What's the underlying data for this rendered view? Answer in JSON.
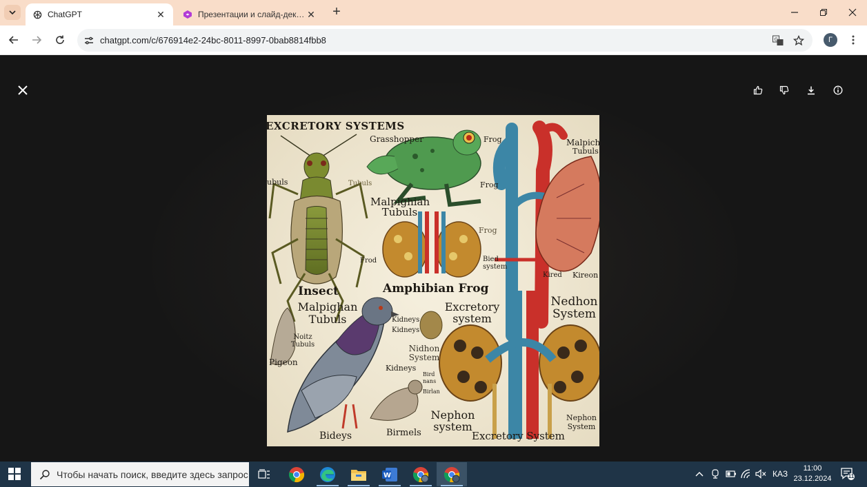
{
  "browser": {
    "tabs": [
      {
        "title": "ChatGPT",
        "active": true
      },
      {
        "title": "Презентации и слайд-деки с AI",
        "active": false
      }
    ],
    "address": "chatgpt.com/c/676914e2-24bc-8011-8997-0bab8814fbb8",
    "profile_initial": "Г"
  },
  "viewer": {
    "actions": [
      "thumbs-up",
      "thumbs-down",
      "download",
      "info"
    ]
  },
  "artwork": {
    "labels": {
      "title": "EXCRETORY SYSTEMS",
      "grasshopper": "Grasshopper",
      "frog_top": "Frog",
      "malpich": "Malpich",
      "tubuls_top": "Tubuls",
      "tubuls_left": "ubuls",
      "tubuls_insect": "Tubuls",
      "frog_mid": "Frog",
      "malpighian_tubuls_mid": "Malpighian Tubuls",
      "frog_small": "Frog",
      "frod": "Frod",
      "bird_system": "Bied system",
      "kired": "Kired",
      "kireon": "Kireon",
      "insect": "Insect",
      "amphibian_frog": "Amphibian Frog",
      "malpighan_tubuls": "Malpighan Tubuls",
      "excretory_system_mid": "Excretory system",
      "nedhon_system": "Nedhon System",
      "kidneys1": "Kidneys",
      "kidneys2": "Kidneys",
      "noitz_tubuls": "Noitz Tubuls",
      "nidhon_system": "Nidhon System",
      "pigeon": "Pigeon",
      "kidneys3": "Kidneys",
      "bird_nans": "Bird nans",
      "birlan": "Birlan",
      "nephon_system": "Nephon system",
      "nephon_system_right": "Nephon System",
      "bideys": "Bideys",
      "birmels": "Birmels",
      "excretory_system_bottom": "Excretory System"
    }
  },
  "taskbar": {
    "search_placeholder": "Чтобы начать поиск, введите здесь запрос",
    "language": "КАЗ",
    "time": "11:00",
    "date": "23.12.2024",
    "notifications": "11"
  }
}
